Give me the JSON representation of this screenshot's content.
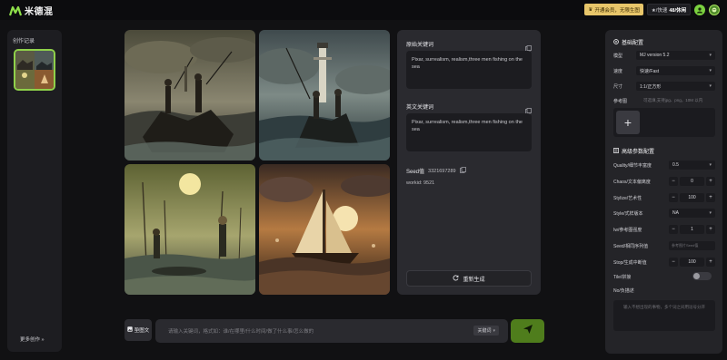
{
  "app": {
    "name": "米德混"
  },
  "header": {
    "vip_label": "开通会员，无限生图",
    "quota_label": "★/快速",
    "quota_value": "48/休闲"
  },
  "sidebar": {
    "title": "创作记录",
    "more_label": "更多创作 »"
  },
  "result": {
    "original_prompt_label": "原始关键词",
    "original_prompt": "Pixar, surrealism, realism,three men fishing on the sea",
    "english_prompt_label": "英文关键词",
    "english_prompt": "Pixar, surrealism, realism,three men fishing on the sea",
    "seed_label": "Seed值",
    "seed_value": "3321697289",
    "worker_id": "workid: 9521",
    "regenerate_label": "重新生成"
  },
  "composer": {
    "mode_label": "垫图文",
    "placeholder": "请输入关键词，格式如：谁/在哪里/什么时间/做了什么事/怎么做的",
    "keyword_select": "关键词"
  },
  "settings": {
    "basic_title": "基础配置",
    "model_label": "模型",
    "model_value": "MJ version 5.2",
    "speed_label": "速度",
    "speed_value": "快速/Fast",
    "size_label": "尺寸",
    "size_value": "1:1/正方形",
    "ref_label": "参考图",
    "ref_hint": "可选填,支持jpg、png，10M 以内",
    "advanced_title": "高级参数配置",
    "quality_label": "Quality/细节丰富度",
    "quality_value": "0.5",
    "chaos_label": "Chaos/文本偏离度",
    "chaos_value": "0",
    "stylize_label": "Stylize/艺术性",
    "stylize_value": "100",
    "style_label": "Style/式样版本",
    "style_value": "NA",
    "iw_label": "Iw/参考图强度",
    "iw_value": "1",
    "seed_label": "Seed/相同序列值",
    "seed_placeholder": "参考图片Seed值",
    "stop_label": "Stop/生成中断值",
    "stop_value": "100",
    "tile_label": "Tile/拼接",
    "no_label": "No/负描述",
    "no_placeholder": "输入不想出现的事物，多个词之间用逗号分开"
  }
}
